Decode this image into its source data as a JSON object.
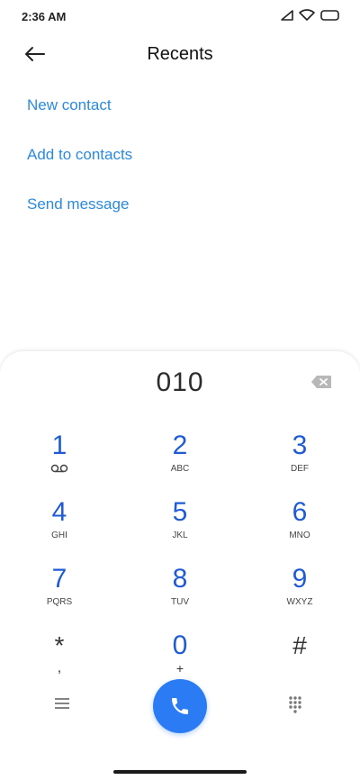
{
  "status_bar": {
    "time": "2:36 AM",
    "icons": [
      "signal-icon",
      "wifi-icon",
      "battery-icon"
    ]
  },
  "header": {
    "title": "Recents",
    "back_icon": "back-arrow-icon"
  },
  "actions": [
    {
      "label": "New contact"
    },
    {
      "label": "Add to contacts"
    },
    {
      "label": "Send message"
    }
  ],
  "dialer": {
    "number": "010",
    "backspace_icon": "backspace-icon",
    "keys": [
      {
        "digit": "1",
        "letters": "",
        "icon": "voicemail-icon"
      },
      {
        "digit": "2",
        "letters": "ABC"
      },
      {
        "digit": "3",
        "letters": "DEF"
      },
      {
        "digit": "4",
        "letters": "GHI"
      },
      {
        "digit": "5",
        "letters": "JKL"
      },
      {
        "digit": "6",
        "letters": "MNO"
      },
      {
        "digit": "7",
        "letters": "PQRS"
      },
      {
        "digit": "8",
        "letters": "TUV"
      },
      {
        "digit": "9",
        "letters": "WXYZ"
      },
      {
        "digit": "*",
        "letters": ","
      },
      {
        "digit": "0",
        "letters": "+"
      },
      {
        "digit": "#",
        "letters": ""
      }
    ],
    "bottom": {
      "menu_icon": "menu-icon",
      "call_icon": "phone-icon",
      "dialpad_icon": "dialpad-icon"
    }
  },
  "colors": {
    "accent_link": "#2a8ae0",
    "digit": "#1e5bd4",
    "call_button": "#2b7cf4"
  }
}
